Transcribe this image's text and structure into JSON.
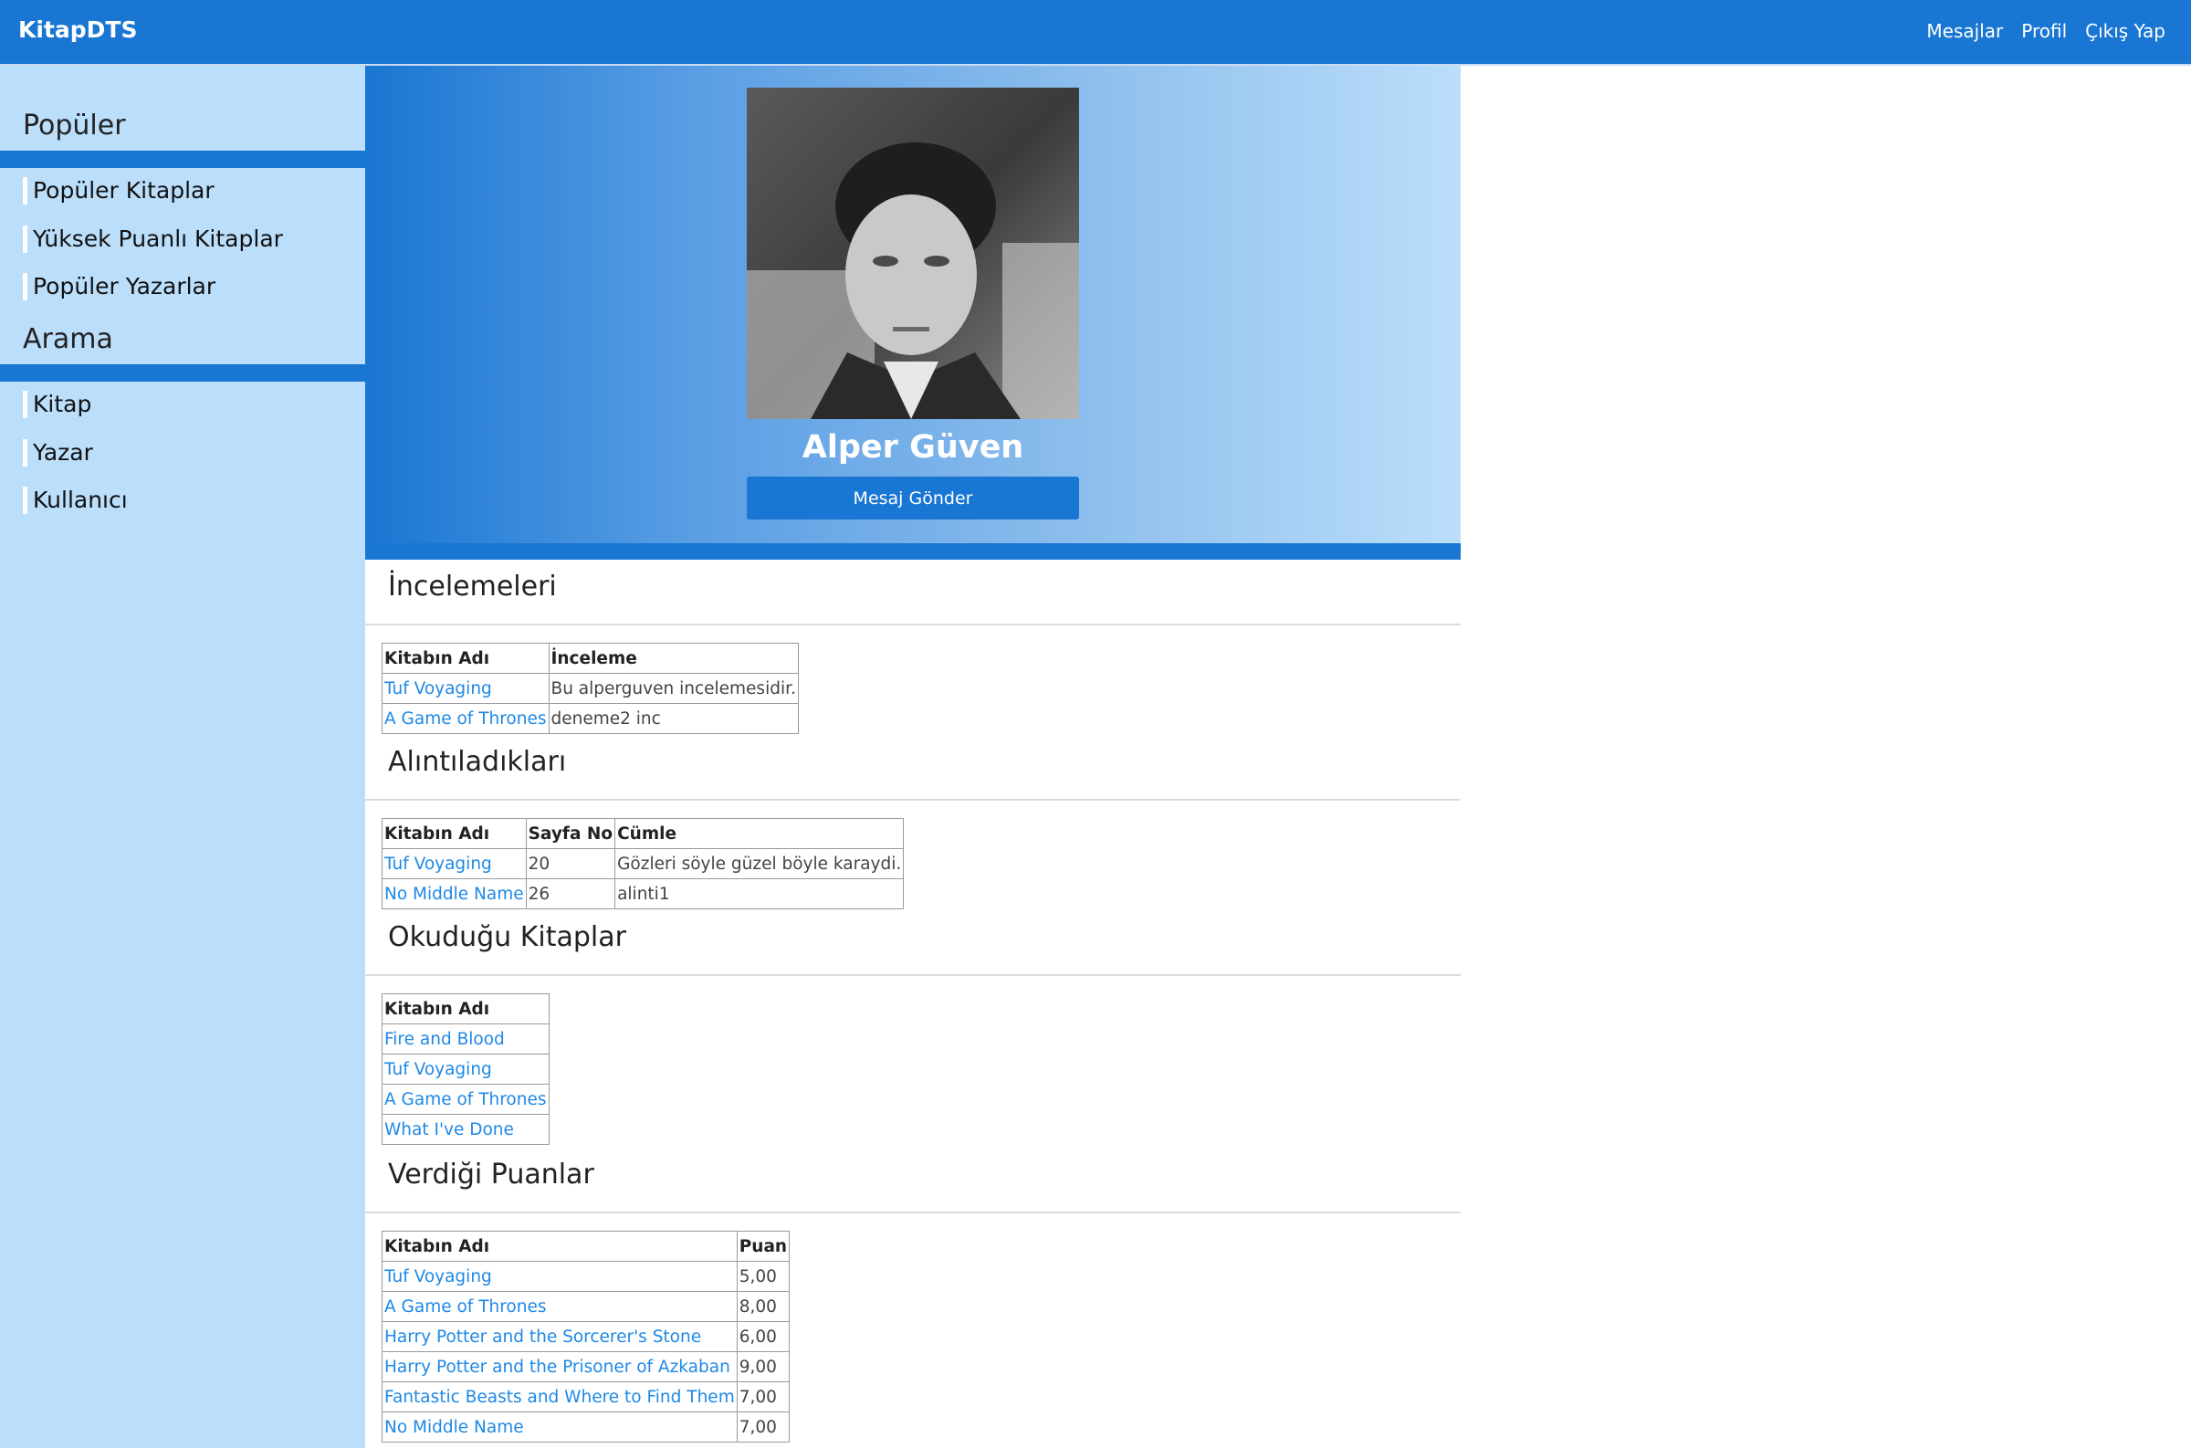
{
  "app": {
    "brand": "KitapDTS"
  },
  "nav": {
    "messages": "Mesajlar",
    "profile": "Profil",
    "logout": "Çıkış Yap"
  },
  "sidebar": {
    "popular_heading": "Popüler",
    "popular_items": [
      "Popüler Kitaplar",
      "Yüksek Puanlı Kitaplar",
      "Popüler Yazarlar"
    ],
    "search_heading": "Arama",
    "search_items": [
      "Kitap",
      "Yazar",
      "Kullanıcı"
    ]
  },
  "profile": {
    "name": "Alper Güven",
    "send_message": "Mesaj Gönder"
  },
  "reviews": {
    "title": "İncelemeleri",
    "headers": [
      "Kitabın Adı",
      "İnceleme"
    ],
    "rows": [
      {
        "book": "Tuf Voyaging",
        "review": "Bu alperguven incelemesidir."
      },
      {
        "book": "A Game of Thrones",
        "review": "deneme2 inc"
      }
    ]
  },
  "quotes": {
    "title": "Alıntıladıkları",
    "headers": [
      "Kitabın Adı",
      "Sayfa No",
      "Cümle"
    ],
    "rows": [
      {
        "book": "Tuf Voyaging",
        "page": "20",
        "sentence": "Gözleri söyle güzel böyle karaydi."
      },
      {
        "book": "No Middle Name",
        "page": "26",
        "sentence": "alinti1"
      }
    ]
  },
  "read_books": {
    "title": "Okuduğu Kitaplar",
    "headers": [
      "Kitabın Adı"
    ],
    "rows": [
      "Fire and Blood",
      "Tuf Voyaging",
      "A Game of Thrones",
      "What I've Done"
    ]
  },
  "ratings": {
    "title": "Verdiği Puanlar",
    "headers": [
      "Kitabın Adı",
      "Puan"
    ],
    "rows": [
      {
        "book": "Tuf Voyaging",
        "score": "5,00"
      },
      {
        "book": "A Game of Thrones",
        "score": "8,00"
      },
      {
        "book": "Harry Potter and the Sorcerer's Stone",
        "score": "6,00"
      },
      {
        "book": "Harry Potter and the Prisoner of Azkaban",
        "score": "9,00"
      },
      {
        "book": "Fantastic Beasts and Where to Find Them",
        "score": "7,00"
      },
      {
        "book": "No Middle Name",
        "score": "7,00"
      }
    ]
  }
}
